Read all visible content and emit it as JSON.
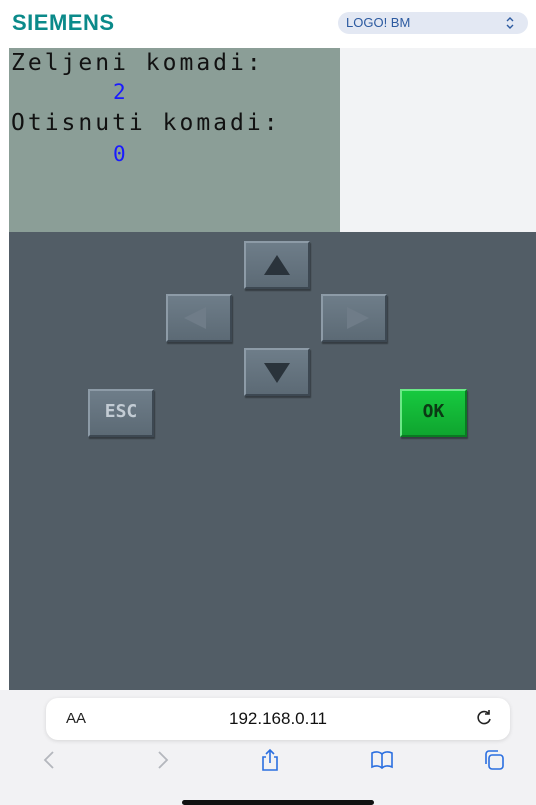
{
  "header": {
    "brand": "SIEMENS",
    "device_select": {
      "selected": "LOGO! BM"
    }
  },
  "lcd": {
    "line1_label": "Zeljeni komadi:",
    "line1_value": "2",
    "line2_label": "Otisnuti komadi:",
    "line2_value": "0"
  },
  "keypad": {
    "esc_label": "ESC",
    "ok_label": "OK",
    "icons": [
      "arrow-up-icon",
      "arrow-left-icon",
      "arrow-right-icon",
      "arrow-down-icon"
    ]
  },
  "browser": {
    "text_size_label": "AA",
    "url": "192.168.0.11",
    "icons": [
      "reload-icon",
      "back-icon",
      "forward-icon",
      "share-icon",
      "bookmarks-icon",
      "tabs-icon"
    ]
  },
  "colors": {
    "brand": "#0b8a8a",
    "lcd_background": "#8b9e97",
    "lcd_value": "#1a1aff",
    "pad_background": "#525d66",
    "ok_button": "#17c93f"
  }
}
